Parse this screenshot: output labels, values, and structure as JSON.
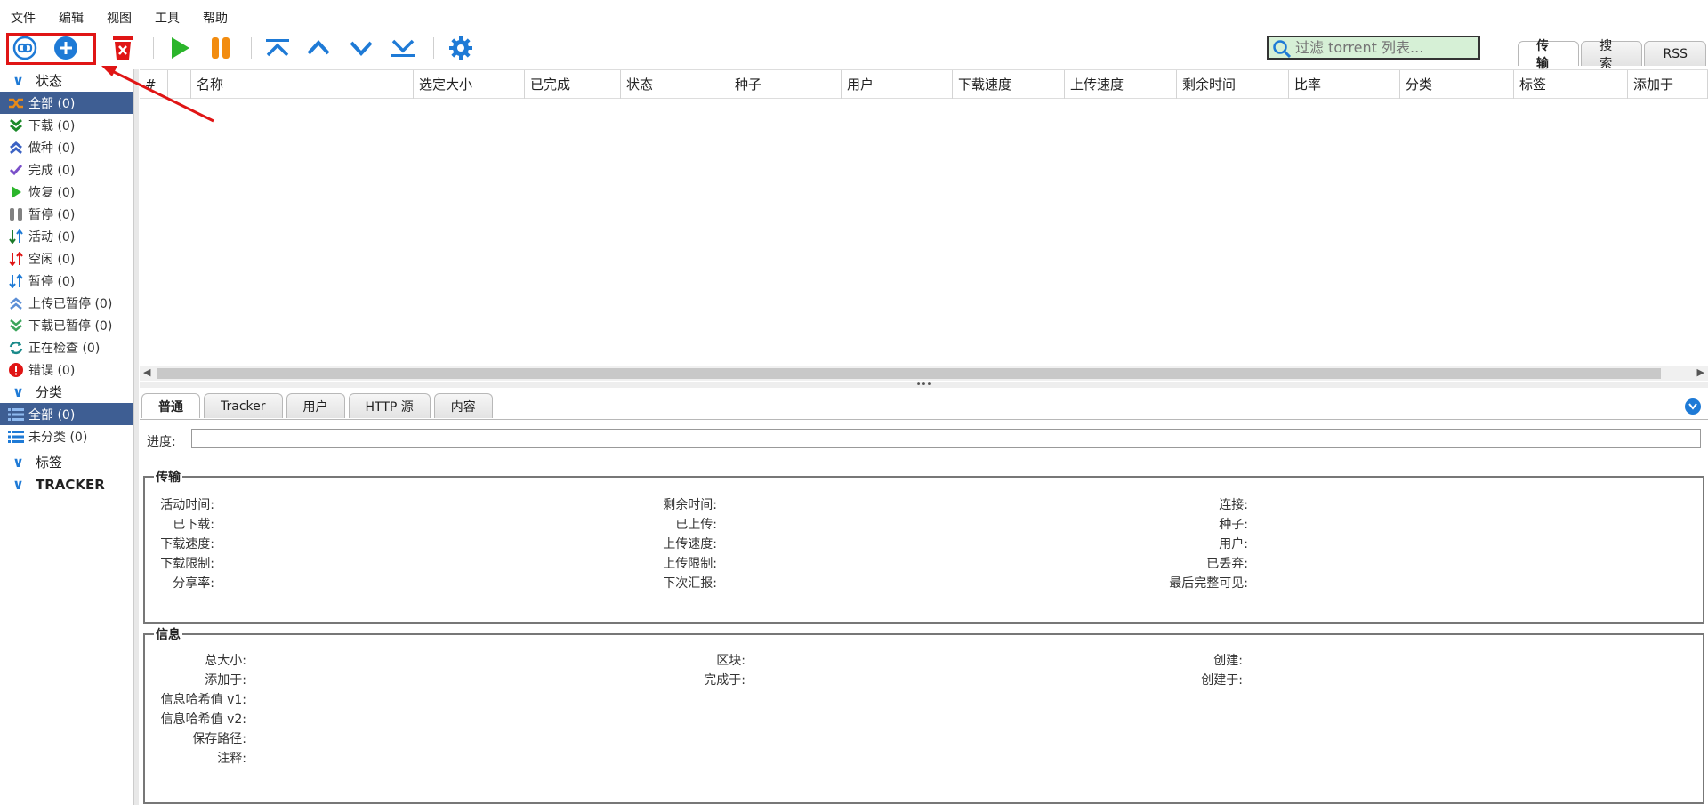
{
  "menu": [
    "文件",
    "编辑",
    "视图",
    "工具",
    "帮助"
  ],
  "search": {
    "placeholder": "过滤 torrent 列表..."
  },
  "right_tabs": [
    "传输",
    "搜索",
    "RSS"
  ],
  "sidebar": {
    "status_header": "状态",
    "status_items": [
      {
        "label": "全部 (0)",
        "icon": "shuffle-icon",
        "color": "#e88a1a"
      },
      {
        "label": "下载 (0)",
        "icon": "double-chevron-down-icon",
        "color": "#1c8a2a"
      },
      {
        "label": "做种 (0)",
        "icon": "double-chevron-up-icon",
        "color": "#3b62c4"
      },
      {
        "label": "完成 (0)",
        "icon": "checkmark-icon",
        "color": "#7a4fc9"
      },
      {
        "label": "恢复 (0)",
        "icon": "play-icon",
        "color": "#2bb52b"
      },
      {
        "label": "暂停 (0)",
        "icon": "pause-icon",
        "color": "#808080"
      },
      {
        "label": "活动 (0)",
        "icon": "up-down-arrows-icon",
        "color": "#1c7a2a"
      },
      {
        "label": "空闲 (0)",
        "icon": "up-down-arrows-red-icon",
        "color": "#e01515"
      },
      {
        "label": "暂停 (0)",
        "icon": "up-down-arrows-blue-icon",
        "color": "#1e7ad6"
      },
      {
        "label": "上传已暂停 (0)",
        "icon": "double-chevron-up-light-icon",
        "color": "#5c8fd6"
      },
      {
        "label": "下载已暂停 (0)",
        "icon": "double-chevron-down-light-icon",
        "color": "#3ca55c"
      },
      {
        "label": "正在检查 (0)",
        "icon": "refresh-icon",
        "color": "#1a8a8a"
      },
      {
        "label": "错误 (0)",
        "icon": "error-icon",
        "color": "#e01515"
      }
    ],
    "category_header": "分类",
    "category_items": [
      {
        "label": "全部 (0)"
      },
      {
        "label": "未分类 (0)"
      }
    ],
    "tags_header": "标签",
    "tracker_header": "TRACKER"
  },
  "columns": [
    "#",
    "",
    "名称",
    "选定大小",
    "已完成",
    "状态",
    "种子",
    "用户",
    "下载速度",
    "上传速度",
    "剩余时间",
    "比率",
    "分类",
    "标签",
    "添加于"
  ],
  "detail_tabs": [
    "普通",
    "Tracker",
    "用户",
    "HTTP 源",
    "内容"
  ],
  "progress_label": "进度:",
  "transfer": {
    "title": "传输",
    "col1": [
      "活动时间:",
      "已下载:",
      "下载速度:",
      "下载限制:",
      "分享率:"
    ],
    "col2": [
      "剩余时间:",
      "已上传:",
      "上传速度:",
      "上传限制:",
      "下次汇报:"
    ],
    "col3": [
      "连接:",
      "种子:",
      "用户:",
      "已丢弃:",
      "最后完整可见:"
    ]
  },
  "info": {
    "title": "信息",
    "col1": [
      "总大小:",
      "添加于:",
      "信息哈希值 v1:",
      "信息哈希值 v2:",
      "保存路径:",
      "注释:"
    ],
    "col2": [
      "区块:",
      "完成于:"
    ],
    "col3": [
      "创建:",
      "创建于:"
    ]
  }
}
